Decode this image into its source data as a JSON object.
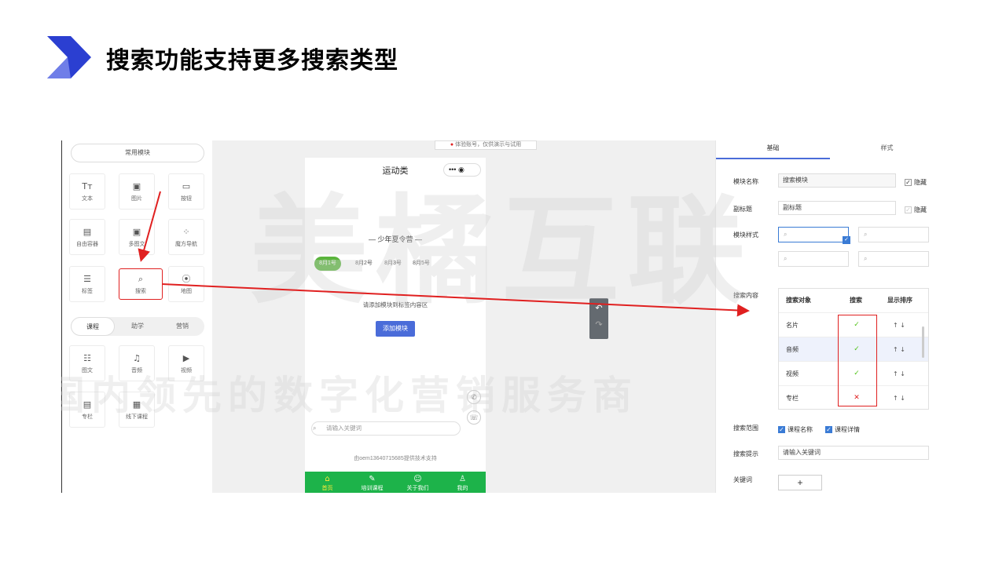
{
  "slide": {
    "title": "搜索功能支持更多搜索类型"
  },
  "left_panel": {
    "header": "常用模块",
    "tiles_common": [
      {
        "label": "文本",
        "icon": "Tт"
      },
      {
        "label": "图片",
        "icon": "▣"
      },
      {
        "label": "按钮",
        "icon": "▭"
      },
      {
        "label": "自由容器",
        "icon": "▤"
      },
      {
        "label": "多图文",
        "icon": "▣"
      },
      {
        "label": "魔方导航",
        "icon": "⁘"
      },
      {
        "label": "标签",
        "icon": "☰"
      },
      {
        "label": "搜索",
        "icon": "⌕"
      },
      {
        "label": "地图",
        "icon": "⦿"
      }
    ],
    "tabs": [
      "课程",
      "助学",
      "营销"
    ],
    "tiles_course": [
      {
        "label": "图文",
        "icon": "☷"
      },
      {
        "label": "音频",
        "icon": "♫"
      },
      {
        "label": "视频",
        "icon": "▶"
      },
      {
        "label": "专栏",
        "icon": "▤"
      },
      {
        "label": "线下课程",
        "icon": "▦"
      }
    ]
  },
  "phone": {
    "toast": "体验账号，仅供演示与试用",
    "title": "运动类",
    "capsule": "•••  ◉",
    "section_title": "— 少年夏令营 —",
    "dates": [
      "8月1号",
      "8月2号",
      "8月3号",
      "8月5号"
    ],
    "hint": "请添加模块到标签内容区",
    "add_button": "添加模块",
    "search_placeholder": "请输入关键词",
    "support": "由oem13640715685提供技术支持",
    "nav": [
      {
        "label": "首页",
        "icon": "⌂"
      },
      {
        "label": "培训课程",
        "icon": "✎"
      },
      {
        "label": "关于我们",
        "icon": "☺"
      },
      {
        "label": "我的",
        "icon": "♙"
      }
    ]
  },
  "right_panel": {
    "tabs": [
      "基础",
      "样式"
    ],
    "module_name_label": "模块名称",
    "module_name_value": "搜索模块",
    "subtitle_label": "副标题",
    "subtitle_value": "副标题",
    "hide_label": "隐藏",
    "style_label": "模块样式",
    "content_label": "搜索内容",
    "table_headers": [
      "搜索对象",
      "搜索",
      "显示排序"
    ],
    "table_rows": [
      {
        "name": "名片",
        "mark": "✓",
        "order": "↑ ↓"
      },
      {
        "name": "音频",
        "mark": "✓",
        "order": "↑ ↓"
      },
      {
        "name": "视频",
        "mark": "✓",
        "order": "↑ ↓"
      },
      {
        "name": "专栏",
        "mark": "✕",
        "order": "↑ ↓"
      }
    ],
    "range_label": "搜索范围",
    "range_options": [
      "课程名称",
      "课程详情"
    ],
    "prompt_label": "搜索提示",
    "prompt_value": "请输入关键词",
    "keyword_label": "关键词",
    "keyword_add": "+"
  },
  "watermark": {
    "big": "美橘互联",
    "line": "国内领先的数字化营销服务商"
  },
  "colors": {
    "accent_blue": "#4a6cd9",
    "nav_green": "#1db34a",
    "highlight_red": "#e02020",
    "check_green": "#52c41a"
  }
}
